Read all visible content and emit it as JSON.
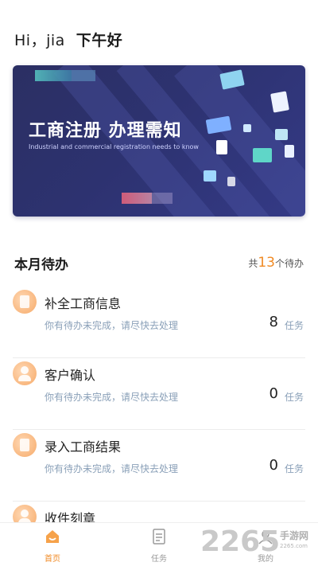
{
  "header": {
    "greeting_prefix": "Hi，jia",
    "greeting": "下午好"
  },
  "banner": {
    "title": "工商注册  办理需知",
    "subtitle": "Industrial and commercial registration needs to know"
  },
  "todo": {
    "section_title": "本月待办",
    "count_prefix": "共",
    "count": "13",
    "count_suffix": "个待办",
    "accent_color": "#f08a24",
    "items": [
      {
        "title": "补全工商信息",
        "desc": "你有待办未完成，请尽快去处理",
        "count": "8",
        "unit": "任务",
        "icon": "document-icon"
      },
      {
        "title": "客户确认",
        "desc": "你有待办未完成，请尽快去处理",
        "count": "0",
        "unit": "任务",
        "icon": "person-icon"
      },
      {
        "title": "录入工商结果",
        "desc": "你有待办未完成，请尽快去处理",
        "count": "0",
        "unit": "任务",
        "icon": "receipt-icon"
      },
      {
        "title": "收件刻章",
        "desc": "",
        "count": "",
        "unit": "",
        "icon": "person-icon"
      }
    ]
  },
  "tabbar": {
    "tabs": [
      {
        "label": "首页",
        "icon": "home-icon",
        "active": true
      },
      {
        "label": "任务",
        "icon": "task-list-icon",
        "active": false
      },
      {
        "label": "我的",
        "icon": "profile-icon",
        "active": false
      }
    ]
  },
  "watermark": {
    "number": "2265",
    "text": "手游网",
    "url": "2265.com"
  }
}
